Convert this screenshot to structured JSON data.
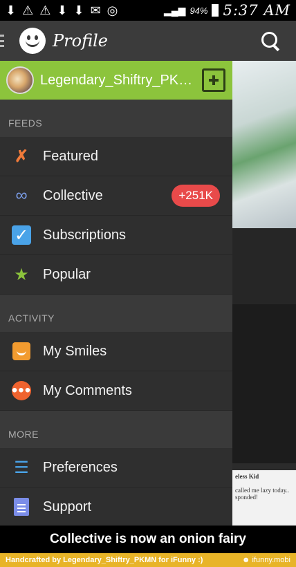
{
  "status_bar": {
    "left_icons": [
      "⬇",
      "⚠",
      "⚠",
      "⬇",
      "⬇",
      "✉",
      "◎"
    ],
    "battery_percent": "94%",
    "time": "5:37 AM"
  },
  "app_bar": {
    "title": "Profile",
    "logo_icon": "smiley-icon",
    "search_icon": "search-icon"
  },
  "user": {
    "name": "Legendary_Shiftry_PK…",
    "add_icon": "add-post-icon"
  },
  "sections": {
    "feeds": "FEEDS",
    "activity": "ACTIVITY",
    "more": "MORE"
  },
  "menu": {
    "featured": "Featured",
    "collective": "Collective",
    "collective_badge": "+251K",
    "subscriptions": "Subscriptions",
    "popular": "Popular",
    "my_smiles": "My Smiles",
    "my_comments": "My Comments",
    "preferences": "Preferences",
    "support": "Support"
  },
  "background_card": {
    "title": "eless Kid",
    "line1": "called me lazy today..",
    "line2": "sponded!"
  },
  "caption": "Collective is now an onion fairy",
  "footer": {
    "credit": "Handcrafted by Legendary_Shiftry_PKMN for iFunny :)",
    "brand": "☻ ifunny.mobi"
  },
  "colors": {
    "accent_green": "#8cc43c",
    "badge_red": "#e84a4a",
    "drawer_bg": "#333333"
  }
}
